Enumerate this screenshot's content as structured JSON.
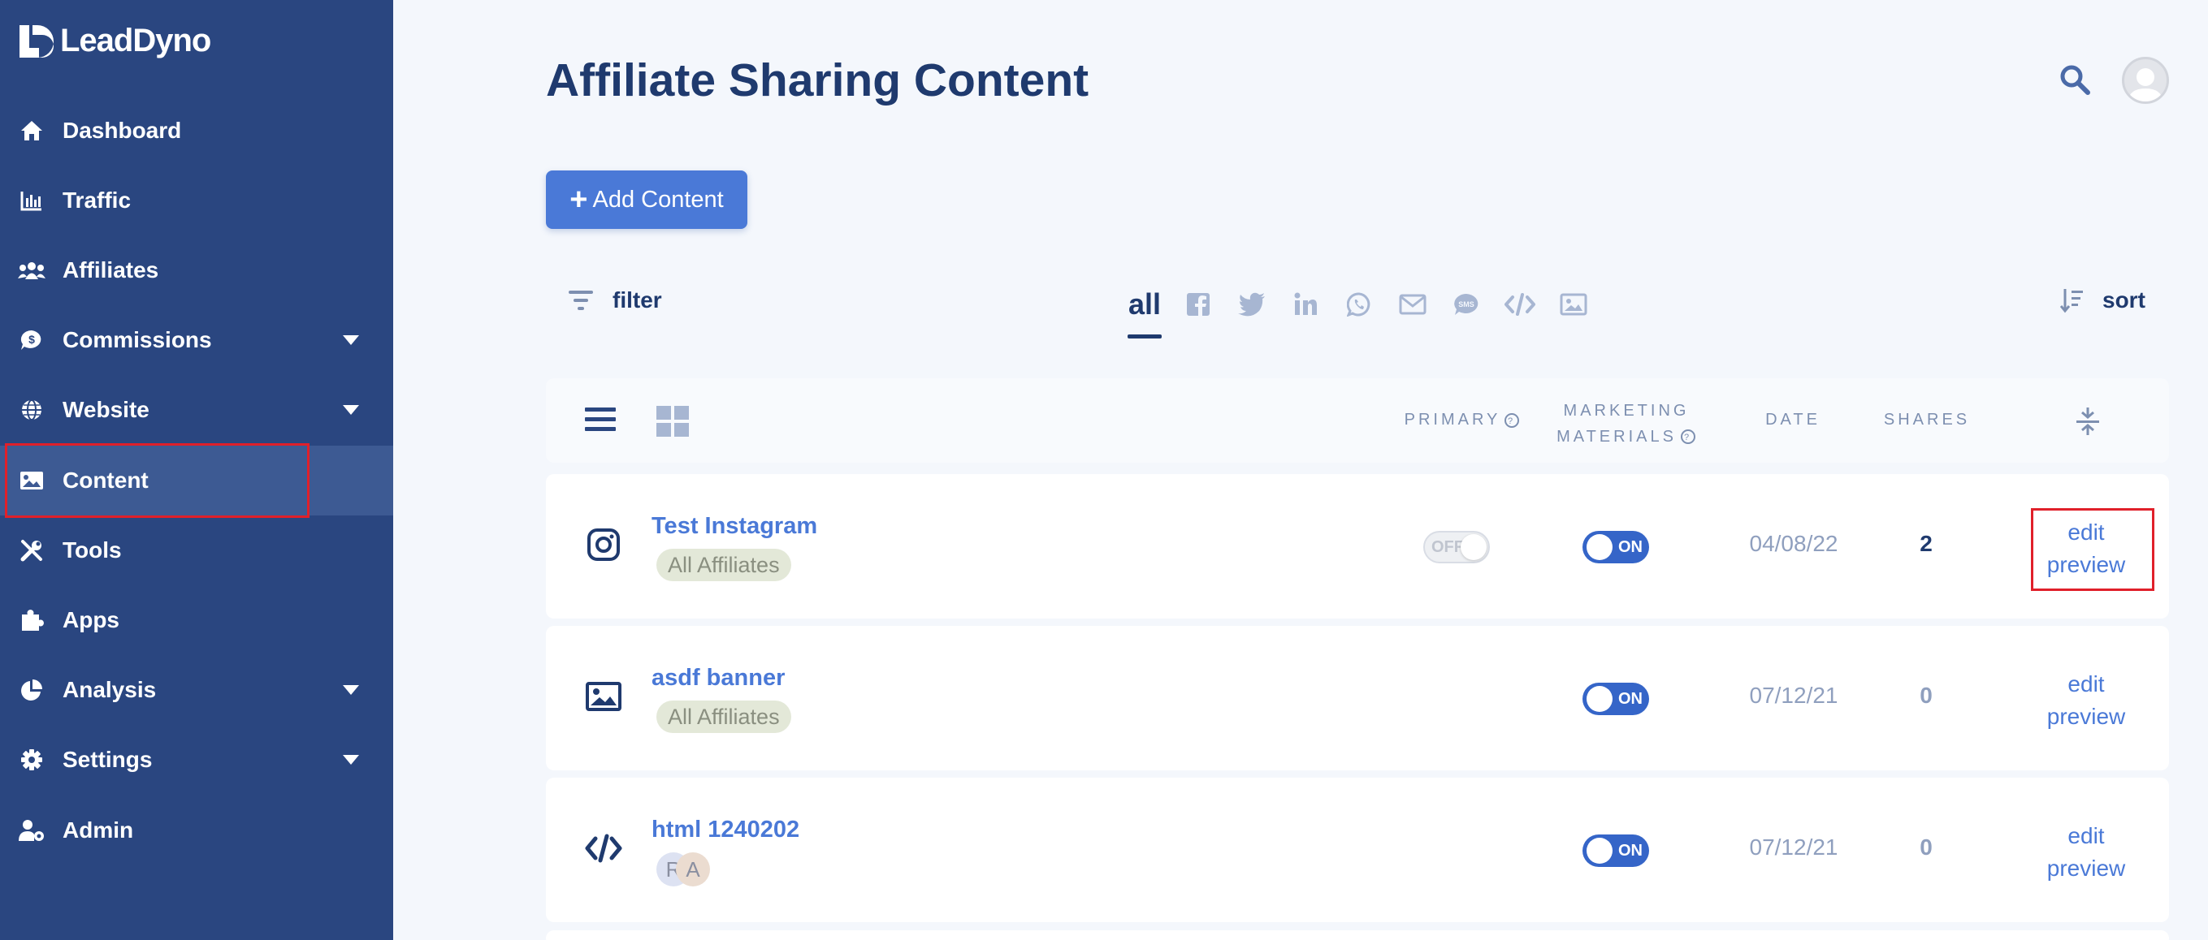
{
  "app": {
    "logo_text": "LeadDyno"
  },
  "sidebar": {
    "items": [
      {
        "label": "Dashboard",
        "icon": "home-icon",
        "has_caret": false
      },
      {
        "label": "Traffic",
        "icon": "bar-chart-icon",
        "has_caret": false
      },
      {
        "label": "Affiliates",
        "icon": "users-icon",
        "has_caret": false
      },
      {
        "label": "Commissions",
        "icon": "dollar-bubble-icon",
        "has_caret": true
      },
      {
        "label": "Website",
        "icon": "globe-icon",
        "has_caret": true
      },
      {
        "label": "Content",
        "icon": "image-icon",
        "has_caret": false,
        "active": true
      },
      {
        "label": "Tools",
        "icon": "tools-icon",
        "has_caret": false
      },
      {
        "label": "Apps",
        "icon": "puzzle-icon",
        "has_caret": false
      },
      {
        "label": "Analysis",
        "icon": "pie-chart-icon",
        "has_caret": true
      },
      {
        "label": "Settings",
        "icon": "gear-icon",
        "has_caret": true
      },
      {
        "label": "Admin",
        "icon": "user-gear-icon",
        "has_caret": false
      }
    ]
  },
  "header": {
    "title": "Affiliate Sharing Content"
  },
  "toolbar": {
    "add_label": "Add Content",
    "filter_label": "filter",
    "sort_label": "sort",
    "tabs": [
      {
        "label": "all",
        "active": true
      },
      {
        "icon": "facebook-icon"
      },
      {
        "icon": "twitter-icon"
      },
      {
        "icon": "linkedin-icon"
      },
      {
        "icon": "whatsapp-icon"
      },
      {
        "icon": "email-icon"
      },
      {
        "icon": "sms-icon"
      },
      {
        "icon": "code-icon"
      },
      {
        "icon": "image-icon"
      }
    ]
  },
  "table": {
    "headers": {
      "primary": "PRIMARY",
      "marketing_line1": "MARKETING",
      "marketing_line2": "MATERIALS",
      "date": "DATE",
      "shares": "SHARES"
    },
    "rows": [
      {
        "icon": "instagram-icon",
        "title": "Test Instagram",
        "tag": "All Affiliates",
        "primary": "OFF",
        "marketing": "ON",
        "date": "04/08/22",
        "shares": "2",
        "edit": "edit",
        "preview": "preview"
      },
      {
        "icon": "image-icon",
        "title": "asdf banner",
        "tag": "All Affiliates",
        "marketing": "ON",
        "date": "07/12/21",
        "shares": "0",
        "edit": "edit",
        "preview": "preview"
      },
      {
        "icon": "code-icon",
        "title": "html 1240202",
        "tag_letters": [
          "R",
          "A"
        ],
        "marketing": "ON",
        "date": "07/12/21",
        "shares": "0",
        "edit": "edit",
        "preview": "preview"
      }
    ]
  },
  "colors": {
    "sidebar_bg": "#2a4680",
    "sidebar_active": "#3d5a93",
    "accent": "#4a79d7",
    "toggle_on": "#3565c8",
    "title": "#1f3a6e",
    "highlight": "#e0202a"
  }
}
